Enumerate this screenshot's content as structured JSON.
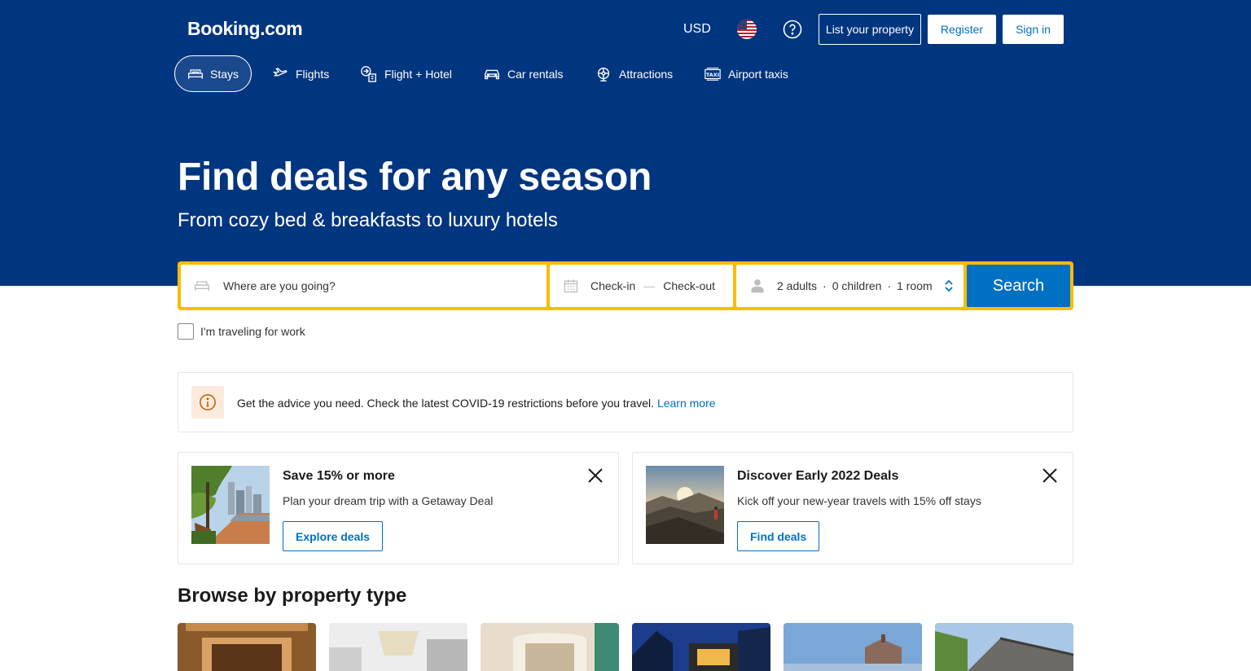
{
  "header": {
    "logo": "Booking.com",
    "currency": "USD",
    "list_property": "List your property",
    "register": "Register",
    "sign_in": "Sign in"
  },
  "nav": {
    "items": [
      {
        "label": "Stays",
        "icon": "bed-icon",
        "active": true
      },
      {
        "label": "Flights",
        "icon": "plane-icon"
      },
      {
        "label": "Flight + Hotel",
        "icon": "flight-hotel-icon"
      },
      {
        "label": "Car rentals",
        "icon": "car-icon"
      },
      {
        "label": "Attractions",
        "icon": "attractions-icon"
      },
      {
        "label": "Airport taxis",
        "icon": "taxi-icon"
      }
    ]
  },
  "hero": {
    "title": "Find deals for any season",
    "subtitle": "From cozy bed & breakfasts to luxury hotels"
  },
  "search": {
    "destination_placeholder": "Where are you going?",
    "check_in": "Check-in",
    "dash": "—",
    "check_out": "Check-out",
    "adults": "2 adults",
    "children": "0 children",
    "rooms": "1 room",
    "dot": "·",
    "button": "Search",
    "work_label": "I'm traveling for work"
  },
  "covid": {
    "text": "Get the advice you need. Check the latest COVID-19 restrictions before you travel.",
    "link": "Learn more"
  },
  "promos": [
    {
      "title": "Save 15% or more",
      "desc": "Plan your dream trip with a Getaway Deal",
      "button": "Explore deals"
    },
    {
      "title": "Discover Early 2022 Deals",
      "desc": "Kick off your new-year travels with 15% off stays",
      "button": "Find deals"
    }
  ],
  "browse": {
    "title": "Browse by property type"
  },
  "colors": {
    "brand_blue": "#003580",
    "action_blue": "#0071c2",
    "search_yellow": "#febb02"
  }
}
